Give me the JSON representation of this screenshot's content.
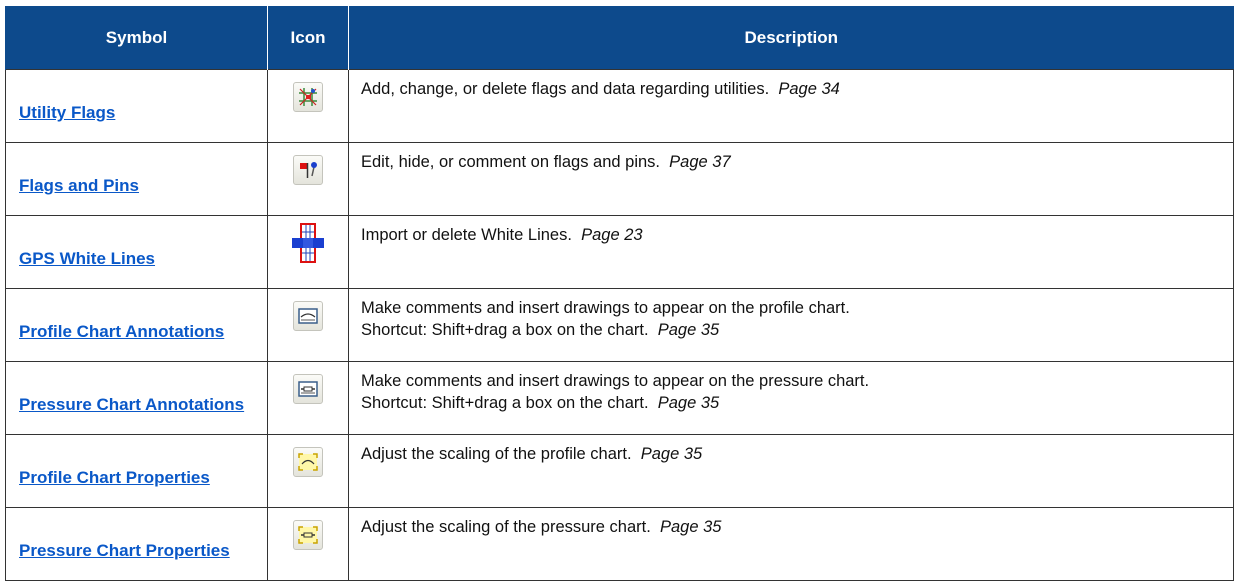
{
  "headers": {
    "symbol": "Symbol",
    "icon": "Icon",
    "description": "Description"
  },
  "rows": [
    {
      "symbol": "Utility Flags",
      "icon": "utility-flags-icon",
      "desc": "Add, change, or delete flags and data regarding utilities.",
      "desc2": "",
      "page": "Page 34"
    },
    {
      "symbol": "Flags and Pins",
      "icon": "flags-and-pins-icon",
      "desc": "Edit, hide, or comment on flags and pins.",
      "desc2": "",
      "page": "Page 37"
    },
    {
      "symbol": "GPS White Lines",
      "icon": "gps-white-lines-icon",
      "desc": "Import or delete White Lines.",
      "desc2": "",
      "page": "Page 23"
    },
    {
      "symbol": "Profile Chart Annotations",
      "icon": "profile-annotation-icon",
      "desc": "Make comments and insert drawings to appear on the profile chart.",
      "desc2": "Shortcut: Shift+drag a box on the chart.",
      "page": "Page 35"
    },
    {
      "symbol": "Pressure Chart Annotations",
      "icon": "pressure-annotation-icon",
      "desc": "Make comments and insert drawings to appear on the pressure chart.",
      "desc2": "Shortcut: Shift+drag a box on the chart.",
      "page": "Page 35"
    },
    {
      "symbol": "Profile Chart Properties",
      "icon": "profile-properties-icon",
      "desc": "Adjust the scaling of the profile chart.",
      "desc2": "",
      "page": "Page 35"
    },
    {
      "symbol": "Pressure Chart Properties",
      "icon": "pressure-properties-icon",
      "desc": "Adjust the scaling of the pressure chart.",
      "desc2": "",
      "page": "Page 35"
    }
  ],
  "colors": {
    "header_bg": "#0d4a8c",
    "link": "#0a58c8",
    "border": "#333333"
  }
}
